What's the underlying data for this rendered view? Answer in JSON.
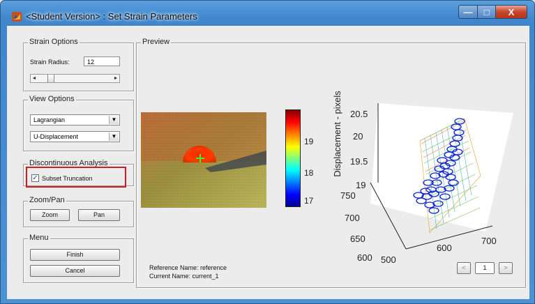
{
  "window": {
    "title": "<Student Version> : Set Strain Parameters",
    "min_glyph": "—",
    "max_glyph": "□",
    "close_glyph": "X"
  },
  "strain_options": {
    "title": "Strain Options",
    "radius_label": "Strain Radius:",
    "radius_value": "12",
    "slider_left": "◄",
    "slider_right": "►"
  },
  "view_options": {
    "title": "View Options",
    "reference_select": "Lagrangian",
    "component_select": "U-Displacement",
    "dropdown_glyph": "▼"
  },
  "discontinuous": {
    "title": "Discontinuous Analysis",
    "checkbox_label": "Subset Truncation",
    "checked": true,
    "check_glyph": "✓"
  },
  "zoom_pan": {
    "title": "Zoom/Pan",
    "zoom_label": "Zoom",
    "pan_label": "Pan"
  },
  "menu": {
    "title": "Menu",
    "finish_label": "Finish",
    "cancel_label": "Cancel"
  },
  "preview": {
    "title": "Preview",
    "reference_name": "Reference Name: reference",
    "current_name": "Current Name: current_1",
    "colorbar_ticks": [
      "19",
      "18",
      "17"
    ],
    "nav_prev": "<",
    "nav_page": "1",
    "nav_next": ">"
  },
  "plot3d": {
    "zlabel": "Displacement - pixels",
    "z_ticks": [
      "20.5",
      "20",
      "19.5",
      "19"
    ],
    "y_ticks": [
      "750",
      "700",
      "650",
      "600"
    ],
    "x_ticks": [
      "500",
      "600",
      "700"
    ]
  },
  "colors": {
    "titlebar": "#4b92d4",
    "highlight_red": "#d21c1c",
    "scatter_blue": "#0a1fd6"
  }
}
